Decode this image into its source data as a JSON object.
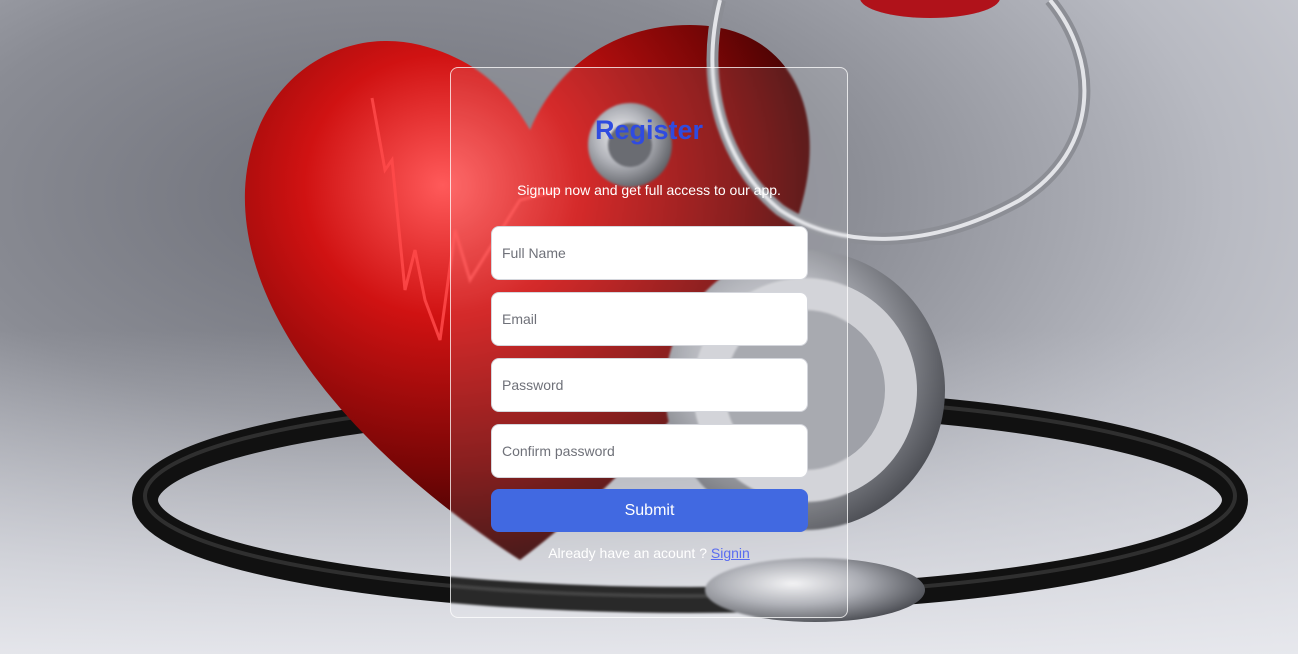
{
  "form": {
    "title": "Register",
    "subtitle": "Signup now and get full access to our app.",
    "fields": [
      {
        "placeholder": "Full Name",
        "value": ""
      },
      {
        "placeholder": "Email",
        "value": ""
      },
      {
        "placeholder": "Password",
        "value": ""
      },
      {
        "placeholder": "Confirm password",
        "value": ""
      }
    ],
    "submit_label": "Submit",
    "signin_prompt": "Already have an acount ?",
    "signin_link": "Signin"
  },
  "colors": {
    "accent": "#4169e1",
    "title": "#2f4be0",
    "link": "#5a6cf0"
  }
}
